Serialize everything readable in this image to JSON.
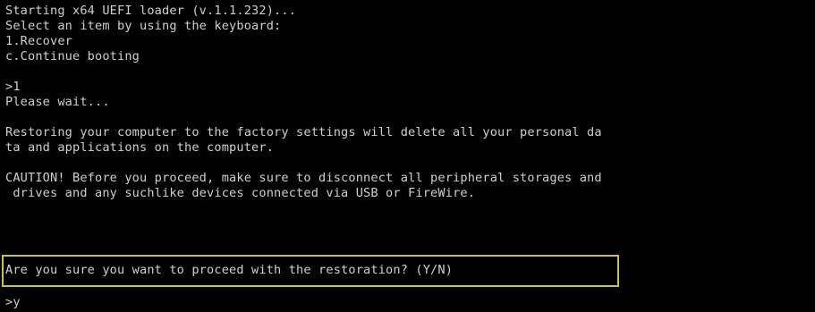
{
  "console": {
    "lines": {
      "loader_title": "Starting x64 UEFI loader (v.1.1.232)...",
      "select_prompt": "Select an item by using the keyboard:",
      "option_recover": "1.Recover",
      "option_continue": "c.Continue booting",
      "input_1": ">1",
      "please_wait": "Please wait...",
      "restore_warning_1": "Restoring your computer to the factory settings will delete all your personal da",
      "restore_warning_2": "ta and applications on the computer.",
      "caution_1": "CAUTION! Before you proceed, make sure to disconnect all peripheral storages and",
      "caution_2": " drives and any suchlike devices connected via USB or FireWire.",
      "confirm_question": "Are you sure you want to proceed with the restoration? (Y/N)",
      "input_2": ">y"
    }
  },
  "colors": {
    "background": "#000000",
    "text": "#cfcfcf",
    "highlight_border": "#c9bf59"
  }
}
